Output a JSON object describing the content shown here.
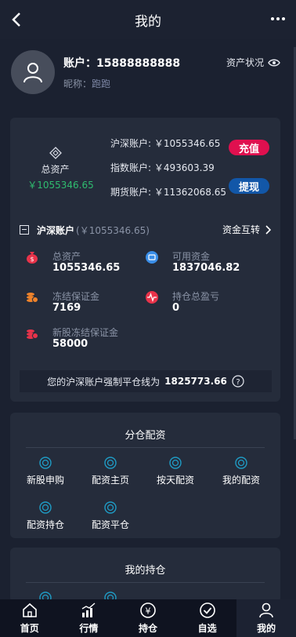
{
  "header": {
    "title": "我的"
  },
  "profile": {
    "account_label": "账户：",
    "account_number": "15888888888",
    "nickname_label": "昵称：",
    "nickname": "跑跑",
    "asset_status": "资产状况"
  },
  "summary": {
    "total_label": "总资产",
    "total_value": "￥1055346.65",
    "accounts": [
      {
        "label": "沪深账户: ",
        "value": "￥1055346.65"
      },
      {
        "label": "指数账户: ",
        "value": "￥493603.39"
      },
      {
        "label": "期货账户: ",
        "value": "￥11362068.65"
      }
    ],
    "recharge_label": "充值",
    "withdraw_label": "提现"
  },
  "section": {
    "title": "沪深账户",
    "subtitle": "(￥1055346.65)",
    "transfer_label": "资金互转"
  },
  "stats": [
    {
      "label": "总资产",
      "value": "1055346.65"
    },
    {
      "label": "可用资金",
      "value": "1837046.82"
    },
    {
      "label": "冻结保证金",
      "value": "7169"
    },
    {
      "label": "持仓总盈亏",
      "value": "0"
    },
    {
      "label": "新股冻结保证金",
      "value": "58000"
    }
  ],
  "liquidation": {
    "text": "您的沪深账户强制平仓线为",
    "value": "1825773.66"
  },
  "allocation": {
    "title": "分仓配资",
    "items": [
      "新股申购",
      "配资主页",
      "按天配资",
      "我的配资",
      "配资持仓",
      "配资平仓"
    ]
  },
  "holdings": {
    "title": "我的持仓"
  },
  "tabs": [
    {
      "label": "首页",
      "icon": "home-icon"
    },
    {
      "label": "行情",
      "icon": "chart-icon"
    },
    {
      "label": "持仓",
      "icon": "yen-icon"
    },
    {
      "label": "自选",
      "icon": "check-icon"
    },
    {
      "label": "我的",
      "icon": "user-icon"
    }
  ],
  "colors": {
    "accent_green": "#2fbc6f",
    "red": "#e0104f",
    "blue": "#1257a8",
    "icon_teal": "#1f9bc4"
  }
}
